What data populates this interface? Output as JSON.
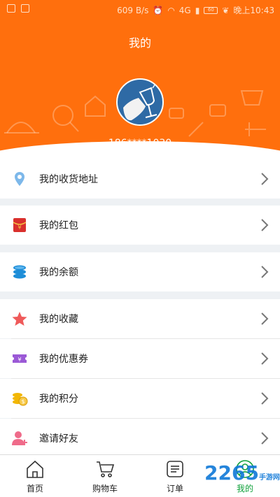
{
  "status_bar": {
    "speed": "609 B/s",
    "network": "4G",
    "battery": "60",
    "time": "晚上10:43"
  },
  "header": {
    "title": "我的",
    "phone": "186****1030"
  },
  "menu": {
    "address": "我的收货地址",
    "redpacket": "我的红包",
    "balance": "我的余额",
    "favorites": "我的收藏",
    "coupons": "我的优惠券",
    "points": "我的积分",
    "invite": "邀请好友"
  },
  "nav": {
    "home": "首页",
    "cart": "购物车",
    "orders": "订单",
    "mine": "我的"
  },
  "watermark": "2265",
  "watermark_sub": "手游网",
  "colors": {
    "header": "#ff6f0d",
    "active_nav": "#11a13c",
    "avatar_bg": "#2e6aa5"
  }
}
